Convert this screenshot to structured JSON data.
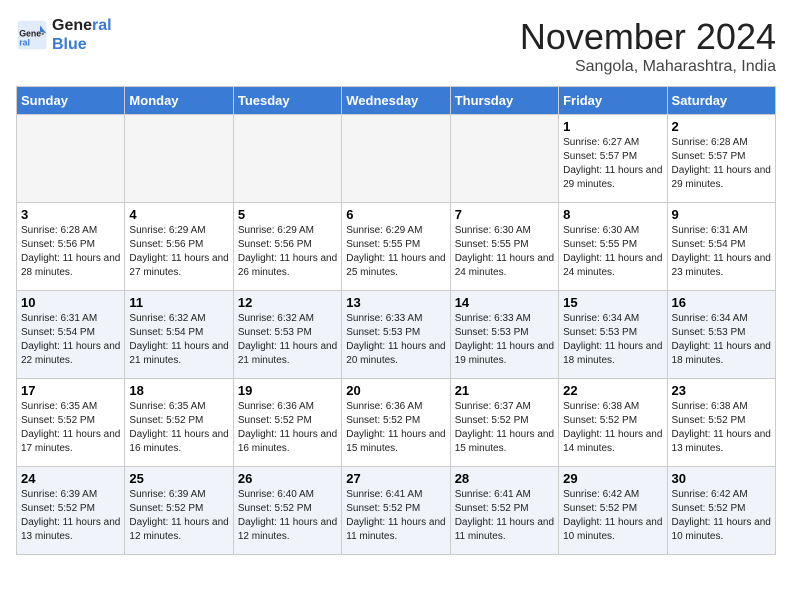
{
  "logo": {
    "line1": "General",
    "line2": "Blue"
  },
  "title": {
    "month": "November 2024",
    "location": "Sangola, Maharashtra, India"
  },
  "weekdays": [
    "Sunday",
    "Monday",
    "Tuesday",
    "Wednesday",
    "Thursday",
    "Friday",
    "Saturday"
  ],
  "weeks": [
    {
      "shade": false,
      "days": [
        {
          "num": "",
          "info": ""
        },
        {
          "num": "",
          "info": ""
        },
        {
          "num": "",
          "info": ""
        },
        {
          "num": "",
          "info": ""
        },
        {
          "num": "",
          "info": ""
        },
        {
          "num": "1",
          "info": "Sunrise: 6:27 AM\nSunset: 5:57 PM\nDaylight: 11 hours and 29 minutes."
        },
        {
          "num": "2",
          "info": "Sunrise: 6:28 AM\nSunset: 5:57 PM\nDaylight: 11 hours and 29 minutes."
        }
      ]
    },
    {
      "shade": false,
      "days": [
        {
          "num": "3",
          "info": "Sunrise: 6:28 AM\nSunset: 5:56 PM\nDaylight: 11 hours and 28 minutes."
        },
        {
          "num": "4",
          "info": "Sunrise: 6:29 AM\nSunset: 5:56 PM\nDaylight: 11 hours and 27 minutes."
        },
        {
          "num": "5",
          "info": "Sunrise: 6:29 AM\nSunset: 5:56 PM\nDaylight: 11 hours and 26 minutes."
        },
        {
          "num": "6",
          "info": "Sunrise: 6:29 AM\nSunset: 5:55 PM\nDaylight: 11 hours and 25 minutes."
        },
        {
          "num": "7",
          "info": "Sunrise: 6:30 AM\nSunset: 5:55 PM\nDaylight: 11 hours and 24 minutes."
        },
        {
          "num": "8",
          "info": "Sunrise: 6:30 AM\nSunset: 5:55 PM\nDaylight: 11 hours and 24 minutes."
        },
        {
          "num": "9",
          "info": "Sunrise: 6:31 AM\nSunset: 5:54 PM\nDaylight: 11 hours and 23 minutes."
        }
      ]
    },
    {
      "shade": true,
      "days": [
        {
          "num": "10",
          "info": "Sunrise: 6:31 AM\nSunset: 5:54 PM\nDaylight: 11 hours and 22 minutes."
        },
        {
          "num": "11",
          "info": "Sunrise: 6:32 AM\nSunset: 5:54 PM\nDaylight: 11 hours and 21 minutes."
        },
        {
          "num": "12",
          "info": "Sunrise: 6:32 AM\nSunset: 5:53 PM\nDaylight: 11 hours and 21 minutes."
        },
        {
          "num": "13",
          "info": "Sunrise: 6:33 AM\nSunset: 5:53 PM\nDaylight: 11 hours and 20 minutes."
        },
        {
          "num": "14",
          "info": "Sunrise: 6:33 AM\nSunset: 5:53 PM\nDaylight: 11 hours and 19 minutes."
        },
        {
          "num": "15",
          "info": "Sunrise: 6:34 AM\nSunset: 5:53 PM\nDaylight: 11 hours and 18 minutes."
        },
        {
          "num": "16",
          "info": "Sunrise: 6:34 AM\nSunset: 5:53 PM\nDaylight: 11 hours and 18 minutes."
        }
      ]
    },
    {
      "shade": false,
      "days": [
        {
          "num": "17",
          "info": "Sunrise: 6:35 AM\nSunset: 5:52 PM\nDaylight: 11 hours and 17 minutes."
        },
        {
          "num": "18",
          "info": "Sunrise: 6:35 AM\nSunset: 5:52 PM\nDaylight: 11 hours and 16 minutes."
        },
        {
          "num": "19",
          "info": "Sunrise: 6:36 AM\nSunset: 5:52 PM\nDaylight: 11 hours and 16 minutes."
        },
        {
          "num": "20",
          "info": "Sunrise: 6:36 AM\nSunset: 5:52 PM\nDaylight: 11 hours and 15 minutes."
        },
        {
          "num": "21",
          "info": "Sunrise: 6:37 AM\nSunset: 5:52 PM\nDaylight: 11 hours and 15 minutes."
        },
        {
          "num": "22",
          "info": "Sunrise: 6:38 AM\nSunset: 5:52 PM\nDaylight: 11 hours and 14 minutes."
        },
        {
          "num": "23",
          "info": "Sunrise: 6:38 AM\nSunset: 5:52 PM\nDaylight: 11 hours and 13 minutes."
        }
      ]
    },
    {
      "shade": true,
      "days": [
        {
          "num": "24",
          "info": "Sunrise: 6:39 AM\nSunset: 5:52 PM\nDaylight: 11 hours and 13 minutes."
        },
        {
          "num": "25",
          "info": "Sunrise: 6:39 AM\nSunset: 5:52 PM\nDaylight: 11 hours and 12 minutes."
        },
        {
          "num": "26",
          "info": "Sunrise: 6:40 AM\nSunset: 5:52 PM\nDaylight: 11 hours and 12 minutes."
        },
        {
          "num": "27",
          "info": "Sunrise: 6:41 AM\nSunset: 5:52 PM\nDaylight: 11 hours and 11 minutes."
        },
        {
          "num": "28",
          "info": "Sunrise: 6:41 AM\nSunset: 5:52 PM\nDaylight: 11 hours and 11 minutes."
        },
        {
          "num": "29",
          "info": "Sunrise: 6:42 AM\nSunset: 5:52 PM\nDaylight: 11 hours and 10 minutes."
        },
        {
          "num": "30",
          "info": "Sunrise: 6:42 AM\nSunset: 5:52 PM\nDaylight: 11 hours and 10 minutes."
        }
      ]
    }
  ]
}
